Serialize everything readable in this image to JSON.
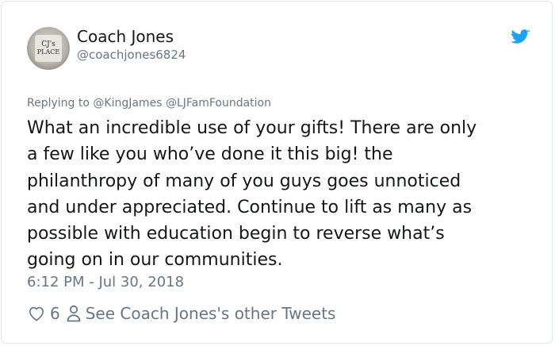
{
  "author": {
    "display_name": "Coach Jones",
    "handle": "@coachjones6824",
    "avatar_text_line1": "CJ's",
    "avatar_text_line2": "PLACE"
  },
  "reply": {
    "prefix": "Replying to",
    "mentions": [
      "@KingJames",
      "@LJFamFoundation"
    ]
  },
  "tweet": {
    "lines": [
      "What an incredible use of your gifts! There are only",
      "a few like you who’ve done it this big! the",
      "philanthropy of many of you guys goes unnoticed",
      "and under appreciated. Continue to lift as many as",
      "possible with education begin to reverse what’s",
      "going on in our communities."
    ]
  },
  "timestamp": "6:12 PM - Jul 30, 2018",
  "actions": {
    "like_count": "6",
    "other_tweets_label": "See Coach Jones's other Tweets"
  },
  "icons": {
    "brand": "twitter-bird-icon",
    "like": "heart-icon",
    "profile": "person-icon"
  },
  "colors": {
    "brand_blue": "#1da1f2",
    "secondary_text": "#657786",
    "primary_text": "#14171a",
    "border": "#e1e8ed"
  }
}
